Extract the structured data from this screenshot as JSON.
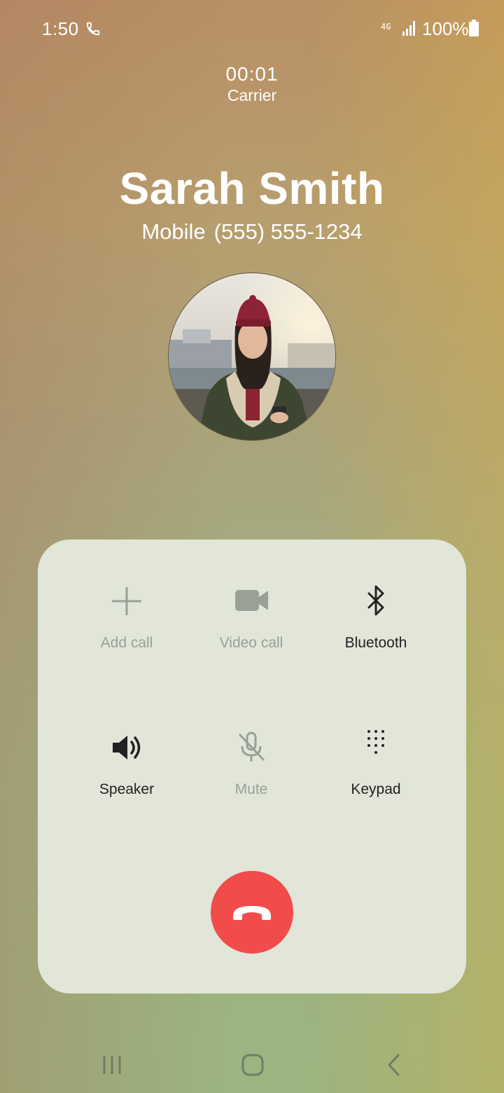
{
  "status_bar": {
    "time": "1:50",
    "network": "4G",
    "battery": "100%"
  },
  "call": {
    "timer": "00:01",
    "carrier": "Carrier",
    "caller_name": "Sarah Smith",
    "number_type": "Mobile",
    "number": "(555) 555-1234"
  },
  "actions": {
    "add_call": "Add call",
    "video_call": "Video call",
    "bluetooth": "Bluetooth",
    "speaker": "Speaker",
    "mute": "Mute",
    "keypad": "Keypad"
  },
  "colors": {
    "end_call": "#f24b4b",
    "panel": "#e1e6d9",
    "disabled": "#9aa096",
    "enabled": "#222222"
  },
  "icons": {
    "recents": "recents-icon",
    "home": "home-icon",
    "back": "back-icon"
  }
}
